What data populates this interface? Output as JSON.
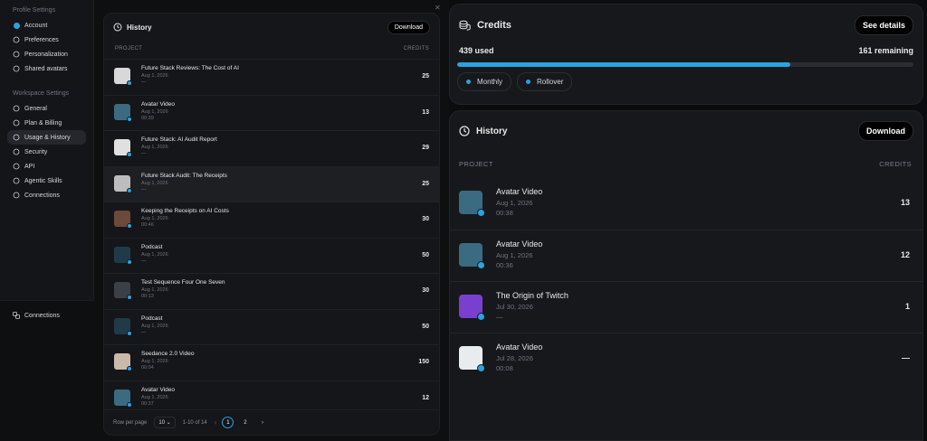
{
  "sidebar": {
    "profile_section": "Profile Settings",
    "profile_items": [
      {
        "label": "Account",
        "icon": "account-icon"
      },
      {
        "label": "Preferences",
        "icon": "sliders-icon"
      },
      {
        "label": "Personalization",
        "icon": "sliders-icon"
      },
      {
        "label": "Shared avatars",
        "icon": "users-icon"
      }
    ],
    "workspace_section": "Workspace Settings",
    "workspace_items": [
      {
        "label": "General",
        "icon": "gear-icon"
      },
      {
        "label": "Plan & Billing",
        "icon": "card-icon"
      },
      {
        "label": "Usage & History",
        "icon": "history-icon",
        "active": true
      },
      {
        "label": "Security",
        "icon": "shield-icon"
      },
      {
        "label": "API",
        "icon": "key-icon"
      },
      {
        "label": "Agentic Skills",
        "icon": "sparkle-icon"
      },
      {
        "label": "Connections",
        "icon": "link-icon"
      }
    ],
    "lower_item": "Connections"
  },
  "mid": {
    "title": "History",
    "download_label": "Download",
    "col_project": "PROJECT",
    "col_credits": "CREDITS",
    "rows": [
      {
        "title": "Future Stack Reviews: The Cost of AI",
        "date": "Aug 1, 2026",
        "sub": "—",
        "credits": "25",
        "thumb": "#d8d8d8"
      },
      {
        "title": "Avatar Video",
        "date": "Aug 1, 2026",
        "sub": "00:39",
        "credits": "13",
        "thumb": "#3b6b80"
      },
      {
        "title": "Future Stack: AI Audit Report",
        "date": "Aug 1, 2026",
        "sub": "—",
        "credits": "29",
        "thumb": "#e0e0e0"
      },
      {
        "title": "Future Stack Audit: The Receipts",
        "date": "Aug 1, 2026",
        "sub": "—",
        "credits": "25",
        "thumb": "#bdbdbd"
      },
      {
        "title": "Keeping the Receipts on AI Costs",
        "date": "Aug 1, 2026",
        "sub": "00:46",
        "credits": "30",
        "thumb": "#6b4a3a"
      },
      {
        "title": "Podcast",
        "date": "Aug 1, 2026",
        "sub": "—",
        "credits": "50",
        "thumb": "#1f3b4a"
      },
      {
        "title": "Test Sequence Four One Seven",
        "date": "Aug 1, 2026",
        "sub": "00:13",
        "credits": "30",
        "thumb": "#3a4046"
      }
    ],
    "lower_rows": [
      {
        "title": "Podcast",
        "date": "Aug 1, 2026",
        "sub": "—",
        "credits": "50",
        "thumb": "#1f3b4a"
      },
      {
        "title": "Seedance 2.0 Video",
        "date": "Aug 1, 2026",
        "sub": "00:04",
        "credits": "150",
        "thumb": "#c9b9a8"
      },
      {
        "title": "Avatar Video",
        "date": "Aug 1, 2026",
        "sub": "00:37",
        "credits": "12",
        "thumb": "#3b6b80"
      }
    ],
    "pager": {
      "rows_label": "Row per page",
      "rows_value": "10",
      "range": "1-10 of 14",
      "prev": "‹",
      "pages": [
        "1",
        "2"
      ],
      "next": "›"
    }
  },
  "credits": {
    "title": "Credits",
    "see_details": "See details",
    "used": "439 used",
    "remaining": "161 remaining",
    "progress_fraction": 0.73,
    "chips": [
      "Monthly",
      "Rollover"
    ],
    "accent": "#2aa3e0"
  },
  "history": {
    "title": "History",
    "download_label": "Download",
    "col_project": "PROJECT",
    "col_credits": "CREDITS",
    "rows": [
      {
        "title": "Avatar Video",
        "date": "Aug 1, 2026",
        "sub": "00:38",
        "credits": "13",
        "thumb": "#3b6b80",
        "badge": "#2aa3e0"
      },
      {
        "title": "Avatar Video",
        "date": "Aug 1, 2026",
        "sub": "00:36",
        "credits": "12",
        "thumb": "#3b6b80",
        "badge": "#2aa3e0"
      },
      {
        "title": "The Origin of Twitch",
        "date": "Jul 30, 2026",
        "sub": "—",
        "credits": "1",
        "thumb": "#7b3fd0",
        "badge": "#2aa3e0"
      },
      {
        "title": "Avatar Video",
        "date": "Jul 28, 2026",
        "sub": "00:08",
        "credits": "—",
        "thumb": "#e9ecef",
        "badge": "#2aa3e0"
      }
    ]
  }
}
